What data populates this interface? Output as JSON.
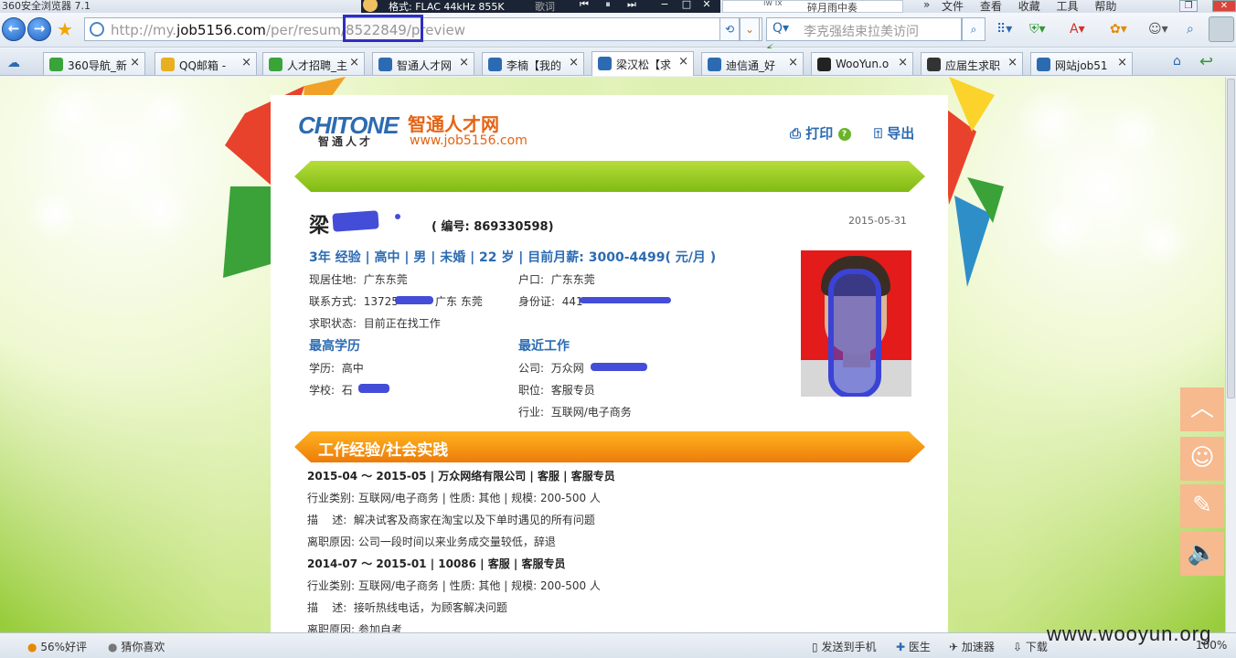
{
  "window": {
    "title": "360安全浏览器 7.1"
  },
  "media": {
    "format": "格式: FLAC 44kHz 855K",
    "lyrics": "歌词",
    "song_left": "iw ix",
    "song_right": "碎月雨中奏"
  },
  "menu": [
    "文件",
    "查看",
    "收藏",
    "工具",
    "帮助"
  ],
  "address": {
    "prefix": "http://my.",
    "domain": "job5156.com",
    "path": "/per/resum",
    "id_part": "/8522849/",
    "suffix": "preview"
  },
  "search": {
    "placeholder": "李克强结束拉美访问"
  },
  "tabs": [
    {
      "label": "360导航_新",
      "color": "#3aa43a"
    },
    {
      "label": "QQ邮箱 -",
      "color": "#e8b020"
    },
    {
      "label": "人才招聘_主",
      "color": "#3aa43a"
    },
    {
      "label": "智通人才网",
      "color": "#2c6bb2"
    },
    {
      "label": "李楠【我的",
      "color": "#2c6bb2"
    },
    {
      "label": "梁汉松【求",
      "color": "#2c6bb2"
    },
    {
      "label": "迪信通_好",
      "color": "#2c6bb2"
    },
    {
      "label": "WooYun.o",
      "color": "#222"
    },
    {
      "label": "应届生求职",
      "color": "#333"
    },
    {
      "label": "网站job51",
      "color": "#2c6bb2"
    }
  ],
  "resume": {
    "logo": {
      "brand": "CHITONE",
      "brand_sub": "智通人才",
      "cn": "智通人才网",
      "url": "www.job5156.com"
    },
    "print": "打印",
    "export": "导出",
    "name": "梁",
    "id_label": "( 编号: 869330598)",
    "date": "2015-05-31",
    "summary": "3年 经验 | 高中 | 男 | 未婚 | 22 岁 | 目前月薪: 3000-4499( 元/月 )",
    "residence": {
      "label": "现居住地:",
      "value": "广东东莞"
    },
    "hukou": {
      "label": "户口:",
      "value": "广东东莞"
    },
    "contact": {
      "label": "联系方式:",
      "value": "13725",
      "value2": "广东 东莞"
    },
    "idcard": {
      "label": "身份证:",
      "value": "441"
    },
    "status": {
      "label": "求职状态:",
      "value": "目前正在找工作"
    },
    "edu_title": "最高学历",
    "recent_title": "最近工作",
    "degree": {
      "label": "学历:",
      "value": "高中"
    },
    "school": {
      "label": "学校:",
      "value": "石"
    },
    "company": {
      "label": "公司:",
      "value": "万众网"
    },
    "position": {
      "label": "职位:",
      "value": "客服专员"
    },
    "industry": {
      "label": "行业:",
      "value": "互联网/电子商务"
    },
    "work_title": "工作经验/社会实践",
    "jobs": [
      {
        "head": "2015-04 ～ 2015-05 | 万众网络有限公司 | 客服 | 客服专员",
        "meta": "行业类别: 互联网/电子商务 | 性质: 其他 | 规模: 200-500 人",
        "desc": "描    述:  解决试客及商家在淘宝以及下单时遇见的所有问题",
        "reason": "离职原因: 公司一段时间以来业务成交量较低，辞退"
      },
      {
        "head": "2014-07 ～ 2015-01 | 10086 | 客服 | 客服专员",
        "meta": "行业类别: 互联网/电子商务 | 性质: 其他 | 规模: 200-500 人",
        "desc": "描    述:  接听热线电话，为顾客解决问题",
        "reason": "离职原因: 参加自考"
      }
    ]
  },
  "status": {
    "rating": "56%好评",
    "guess": "猜你喜欢",
    "send": "发送到手机",
    "doctor": "医生",
    "speed": "加速器",
    "download": "下载",
    "watermark": "www.wooyun.org",
    "zoom": "100%"
  }
}
